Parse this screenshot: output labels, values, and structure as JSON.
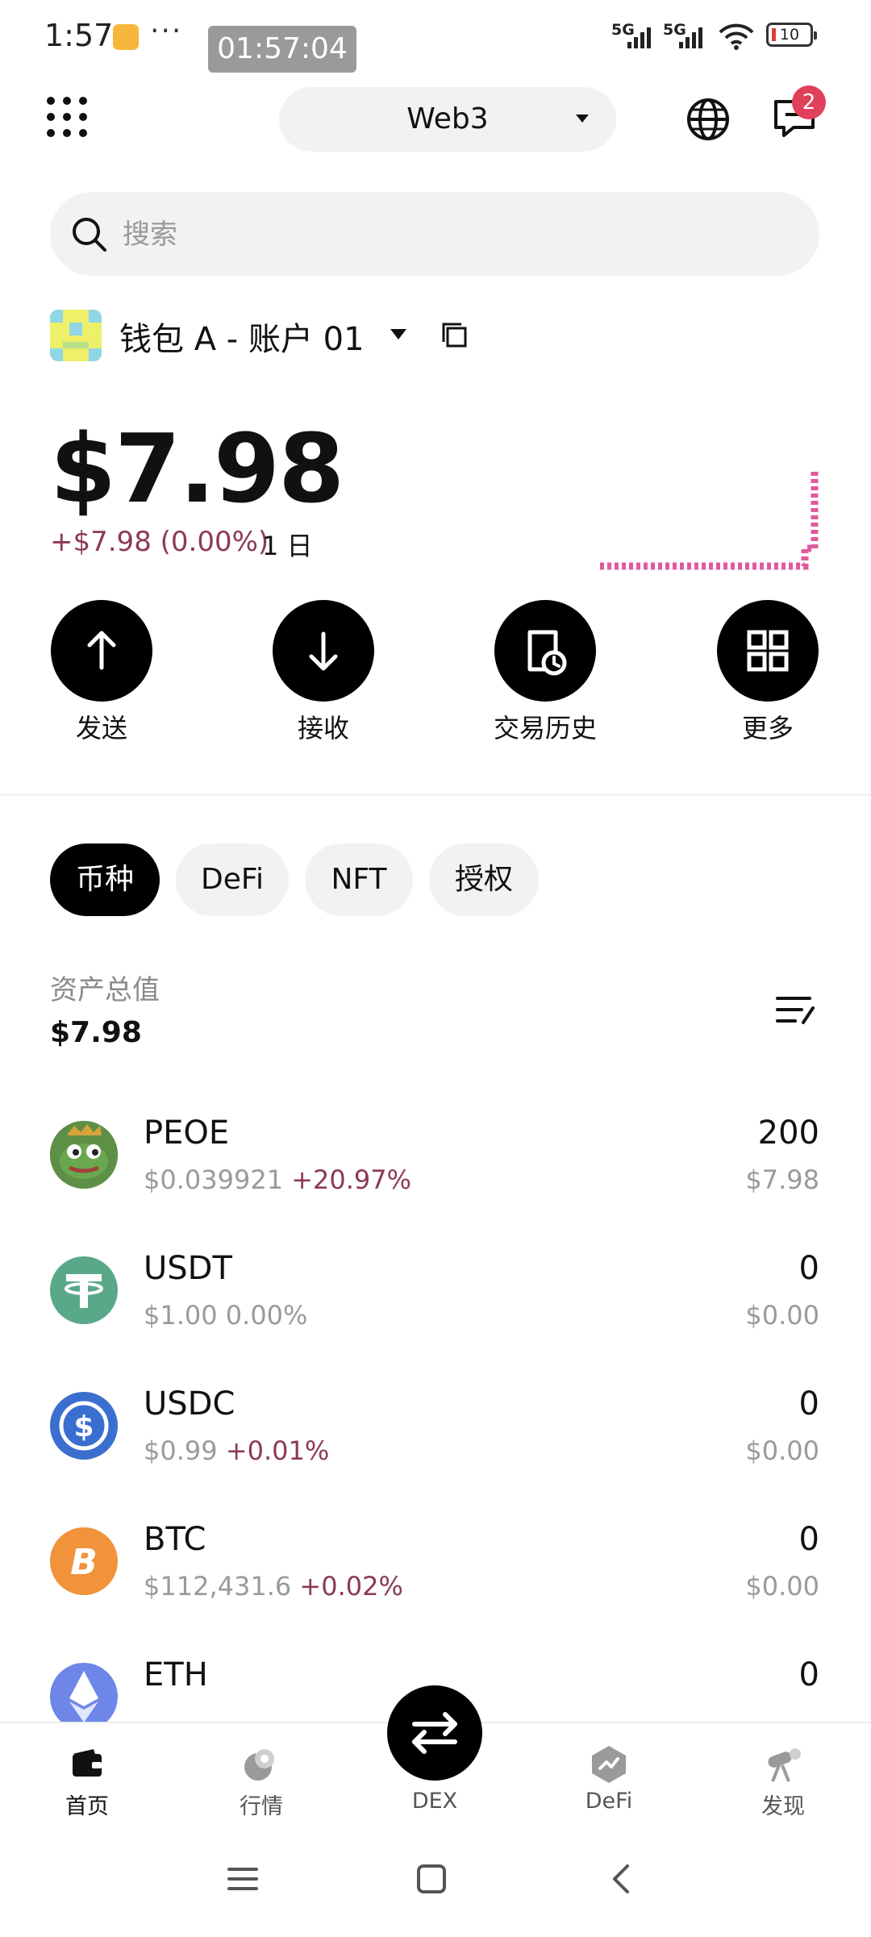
{
  "status_bar": {
    "time": "1:57",
    "overflow": "···",
    "recording_timer": "01:57:04",
    "signal_1": "5G",
    "signal_2": "5G",
    "battery": "10"
  },
  "header": {
    "mode_label": "Web3",
    "notifications_count": "2",
    "icons": [
      "menu-grid-icon",
      "globe-icon",
      "chat-icon"
    ]
  },
  "search": {
    "placeholder": "搜索",
    "value": ""
  },
  "account": {
    "name": "钱包 A - 账户 01"
  },
  "balance": {
    "total": "$7.98",
    "change": "+$7.98 (0.00%)",
    "period": "1 日"
  },
  "actions": [
    {
      "label": "发送",
      "icon": "arrow-up-icon"
    },
    {
      "label": "接收",
      "icon": "arrow-down-icon"
    },
    {
      "label": "交易历史",
      "icon": "history-icon"
    },
    {
      "label": "更多",
      "icon": "grid-icon"
    }
  ],
  "tabs": [
    {
      "label": "币种",
      "active": true
    },
    {
      "label": "DeFi",
      "active": false
    },
    {
      "label": "NFT",
      "active": false
    },
    {
      "label": "授权",
      "active": false
    }
  ],
  "assets": {
    "label": "资产总值",
    "total": "$7.98"
  },
  "tokens": [
    {
      "name": "PEOE",
      "price": "$0.039921",
      "change": "+20.97%",
      "amount": "200",
      "value": "$7.98"
    },
    {
      "name": "USDT",
      "price": "$1.00",
      "change": "0.00%",
      "amount": "0",
      "value": "$0.00"
    },
    {
      "name": "USDC",
      "price": "$0.99",
      "change": "+0.01%",
      "amount": "0",
      "value": "$0.00"
    },
    {
      "name": "BTC",
      "price": "$112,431.6",
      "change": "+0.02%",
      "amount": "0",
      "value": "$0.00"
    },
    {
      "name": "ETH",
      "price": "",
      "change": "",
      "amount": "0",
      "value": ""
    }
  ],
  "bottom_nav": [
    {
      "label": "首页",
      "active": true
    },
    {
      "label": "行情",
      "active": false
    },
    {
      "label": "DEX",
      "active": false
    },
    {
      "label": "DeFi",
      "active": false
    },
    {
      "label": "发现",
      "active": false
    }
  ],
  "colors": {
    "accent_pink": "#e05aa0",
    "positive": "#8c3a56",
    "primary": "#000000"
  }
}
